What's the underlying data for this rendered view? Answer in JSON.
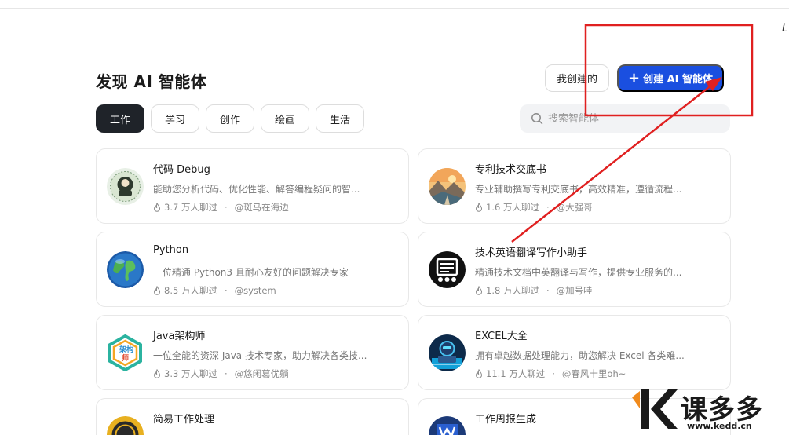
{
  "page": {
    "title": "发现 AI 智能体",
    "corner_glyph": "L"
  },
  "header": {
    "my_created_label": "我创建的",
    "create_label": "创建 AI 智能体"
  },
  "tabs": [
    {
      "label": "工作",
      "active": true
    },
    {
      "label": "学习",
      "active": false
    },
    {
      "label": "创作",
      "active": false
    },
    {
      "label": "绘画",
      "active": false
    },
    {
      "label": "生活",
      "active": false
    }
  ],
  "search": {
    "placeholder": "搜索智能体"
  },
  "cards": [
    {
      "name": "代码 Debug",
      "desc": "能助您分析代码、优化性能、解答编程疑问的智...",
      "count": "3.7 万人聊过",
      "sep": "·",
      "author": "@斑马在海边",
      "icon": "code-debug-avatar"
    },
    {
      "name": "专利技术交底书",
      "desc": "专业辅助撰写专利交底书，高效精准，遵循流程...",
      "count": "1.6 万人聊过",
      "sep": "·",
      "author": "@大强哥",
      "icon": "landscape-avatar"
    },
    {
      "name": "Python",
      "desc": "一位精通 Python3 且耐心友好的问题解决专家",
      "count": "8.5 万人聊过",
      "sep": "·",
      "author": "@system",
      "icon": "globe-avatar"
    },
    {
      "name": "技术英语翻译写作小助手",
      "desc": "精通技术文档中英翻译与写作，提供专业服务的...",
      "count": "1.8 万人聊过",
      "sep": "·",
      "author": "@加号哇",
      "icon": "robot-avatar"
    },
    {
      "name": "Java架构师",
      "desc": "一位全能的资深 Java 技术专家，助力解决各类技...",
      "count": "3.3 万人聊过",
      "sep": "·",
      "author": "@悠闲葛优躺",
      "icon": "java-architect-avatar"
    },
    {
      "name": "EXCEL大全",
      "desc": "拥有卓越数据处理能力，助您解决 Excel 各类难...",
      "count": "11.1 万人聊过",
      "sep": "·",
      "author": "@春风十里oh~",
      "icon": "excel-avatar"
    },
    {
      "name": "简易工作处理",
      "desc": "",
      "count": "",
      "sep": "",
      "author": "",
      "icon": "gold-avatar"
    },
    {
      "name": "工作周报生成",
      "desc": "",
      "count": "",
      "sep": "",
      "author": "",
      "icon": "weekly-report-avatar"
    }
  ],
  "avatar_text": {
    "java": "架构师"
  },
  "watermark": {
    "brand": "课多多",
    "url": "www.kedd.cn"
  },
  "colors": {
    "primary": "#1a4fe0",
    "active_tab": "#1f2329",
    "annotation": "#e02020"
  }
}
